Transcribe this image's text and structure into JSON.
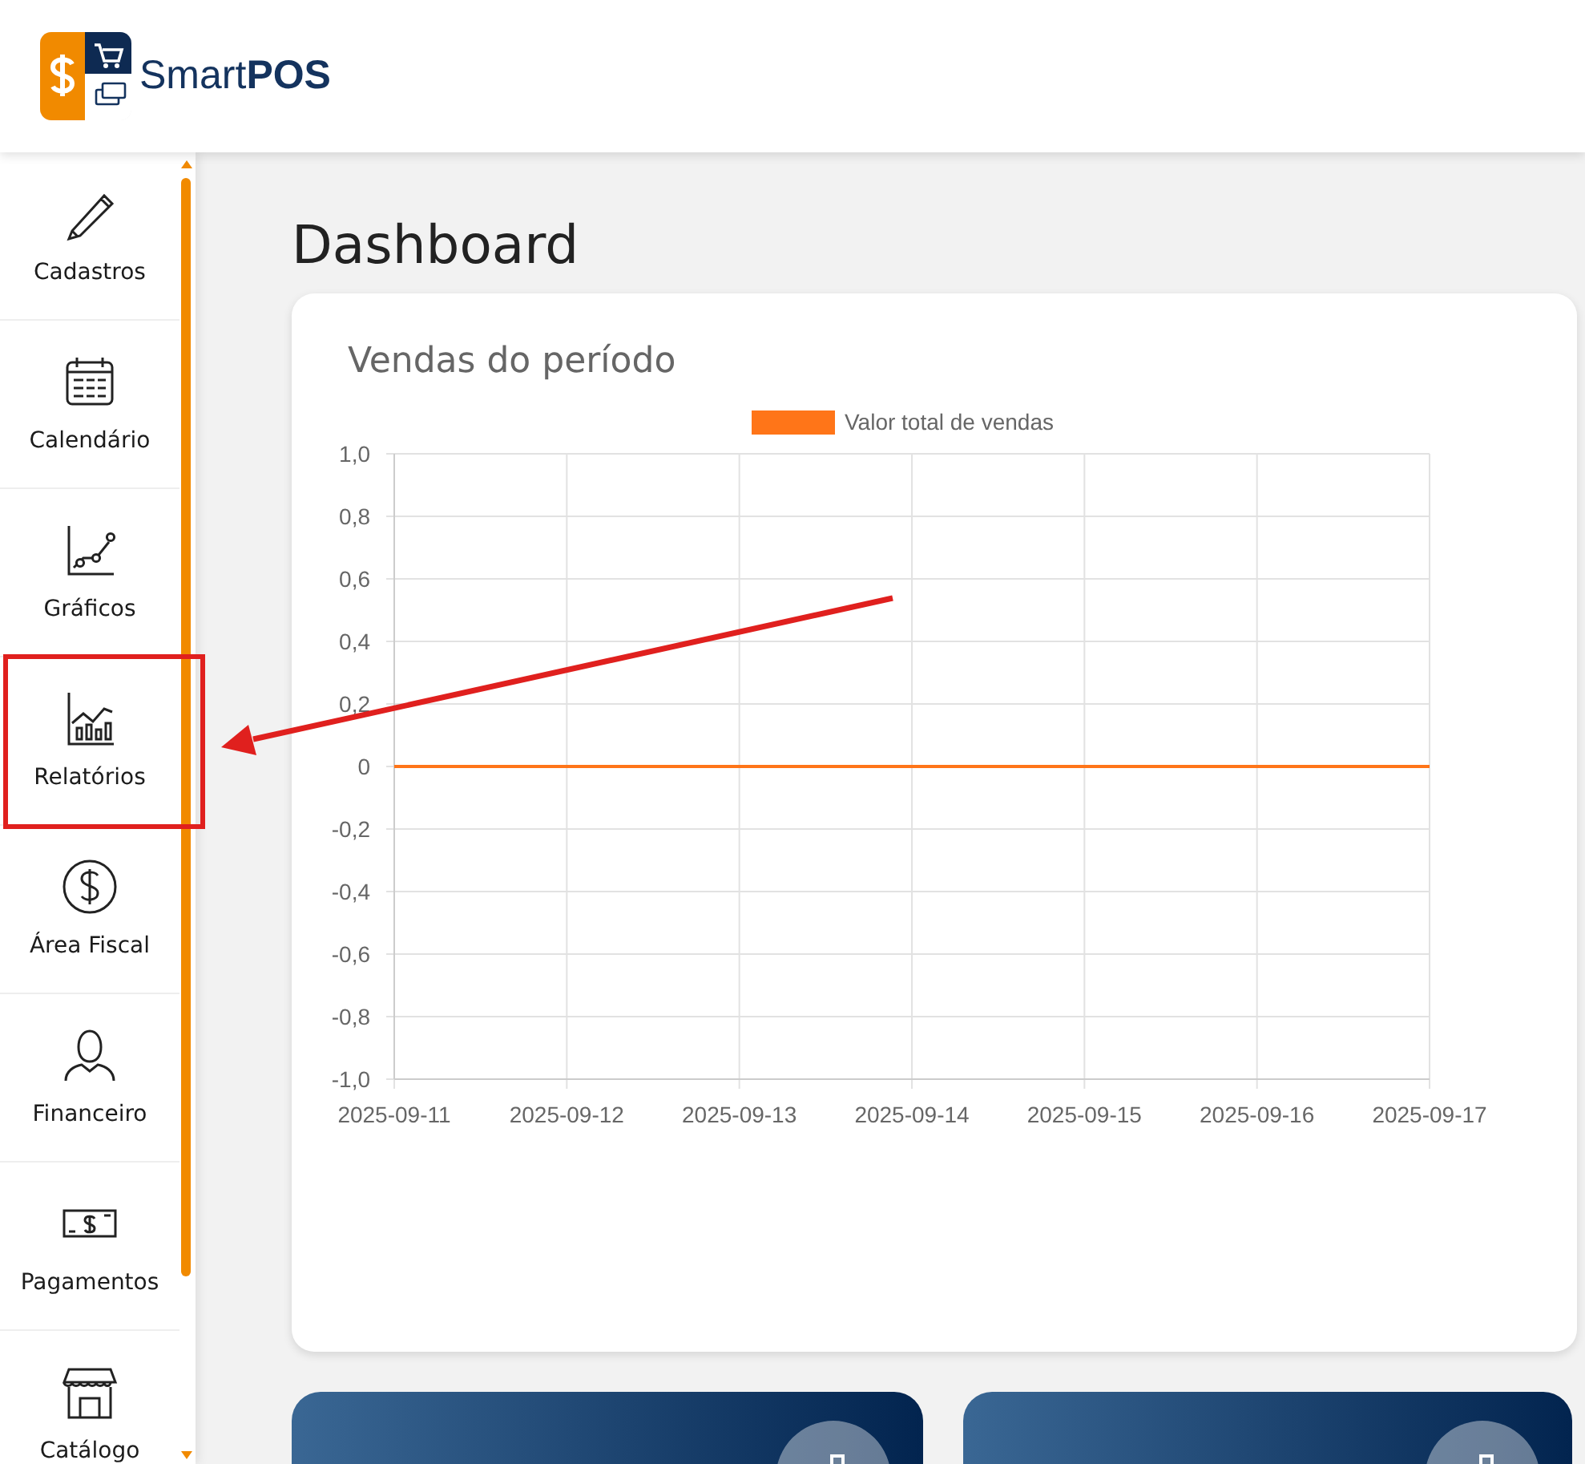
{
  "brand": "Smart**POS**",
  "sidebar": {
    "items": [
      {
        "label": "Cadastros",
        "highlighted": false
      },
      {
        "label": "Calendário",
        "highlighted": false
      },
      {
        "label": "Gráficos",
        "highlighted": false
      },
      {
        "label": "Relatórios",
        "highlighted": true
      },
      {
        "label": "Área Fiscal",
        "highlighted": false
      },
      {
        "label": "Financeiro",
        "highlighted": false
      },
      {
        "label": "Pagamentos",
        "highlighted": false
      },
      {
        "label": "Catálogo",
        "highlighted": false
      }
    ]
  },
  "annotation_arrow": true,
  "page_title": "Dashboard",
  "sales_card": {
    "title": "Vendas do período",
    "chart_data": {
      "type": "line",
      "grid": true,
      "categories": [
        "2025-09-11",
        "2025-09-12",
        "2025-09-13",
        "2025-09-14",
        "2025-09-15",
        "2025-09-16",
        "2025-09-17"
      ],
      "series": [
        {
          "name": "Valor total de vendas",
          "color": "#ff7518",
          "values": [
            0,
            0,
            0,
            0,
            0,
            0,
            0
          ]
        }
      ],
      "ylim": [
        -1,
        1
      ],
      "yticks": [
        {
          "value": 1,
          "label": "1,0"
        },
        {
          "value": 0.8,
          "label": "0,8"
        },
        {
          "value": 0.6,
          "label": "0,6"
        },
        {
          "value": 0.4,
          "label": "0,4"
        },
        {
          "value": 0.2,
          "label": "0,2"
        },
        {
          "value": 0,
          "label": "0"
        },
        {
          "value": -0.2,
          "label": "-0,2"
        },
        {
          "value": -0.4,
          "label": "-0,4"
        },
        {
          "value": -0.6,
          "label": "-0,6"
        },
        {
          "value": -0.8,
          "label": "-0,8"
        },
        {
          "value": -1,
          "label": "-1,0"
        }
      ]
    }
  }
}
